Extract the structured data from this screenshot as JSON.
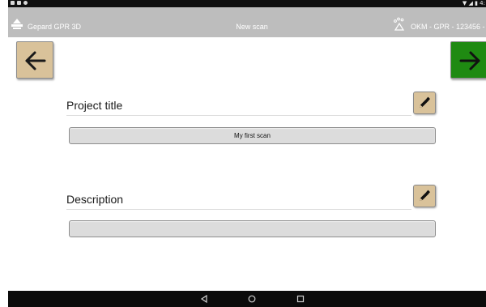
{
  "status_bar": {
    "right_text": "▼ ◢ ▮ 4:"
  },
  "app_bar": {
    "app_name": "Gepard GPR 3D",
    "screen_title": "New scan",
    "device_name": "OKM - GPR - 123456 -",
    "logo_icon": "gepard-logo-icon",
    "device_icon": "paw-print-icon"
  },
  "navigation": {
    "back_icon": "arrow-left-icon",
    "next_icon": "arrow-right-icon",
    "back_color": "#d9c29a",
    "next_color": "#1f8a12"
  },
  "form": {
    "project_title": {
      "label": "Project title",
      "value": "My first scan",
      "edit_icon": "pencil-icon"
    },
    "description": {
      "label": "Description",
      "value": "",
      "edit_icon": "pencil-icon"
    }
  },
  "system_nav": {
    "items": [
      "back-triangle-icon",
      "home-circle-icon",
      "recents-square-icon"
    ]
  }
}
